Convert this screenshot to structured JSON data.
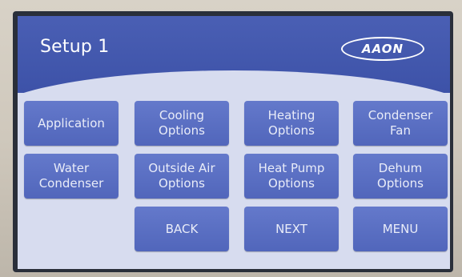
{
  "header": {
    "title": "Setup 1",
    "logo_text": "AAON"
  },
  "buttons": {
    "application": "Application",
    "cooling_options": "Cooling\nOptions",
    "heating_options": "Heating\nOptions",
    "condenser_fan": "Condenser\nFan",
    "water_condenser": "Water\nCondenser",
    "outside_air_options": "Outside Air\nOptions",
    "heat_pump_options": "Heat Pump\nOptions",
    "dehum_options": "Dehum\nOptions",
    "back": "BACK",
    "next": "NEXT",
    "menu": "MENU"
  },
  "colors": {
    "header_blue": "#3d52a8",
    "button_blue": "#5a6fc2",
    "screen_background": "#d7dcef",
    "button_text": "#e9ecf8"
  }
}
